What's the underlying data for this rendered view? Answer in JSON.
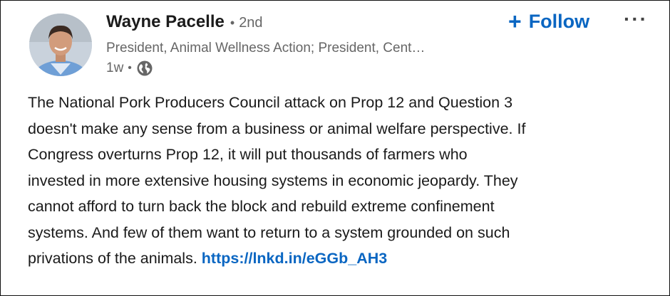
{
  "author": {
    "name": "Wayne Pacelle",
    "separator": "•",
    "connection_degree": "2nd",
    "headline": "President, Animal Wellness Action; President, Cent…",
    "time_ago": "1w",
    "meta_separator": "•",
    "visibility_icon": "globe-icon"
  },
  "actions": {
    "follow_label": "Follow",
    "follow_icon": "+",
    "more_label": "···"
  },
  "post": {
    "lines": [
      "The National Pork Producers Council attack on Prop 12 and Question 3",
      "doesn't make any sense from a business or animal welfare perspective. If",
      "Congress overturns Prop 12, it will put thousands of farmers who",
      "invested in more extensive housing systems in economic jeopardy. They",
      "cannot afford to turn back the block and rebuild extreme confinement",
      "systems. And few of them want to return to a system grounded on such"
    ],
    "last_line_text": "privations of the animals. ",
    "link_text": "https://lnkd.in/eGGb_AH3"
  },
  "colors": {
    "accent": "#0a66c2",
    "secondary_text": "#666666",
    "border": "#111111"
  }
}
